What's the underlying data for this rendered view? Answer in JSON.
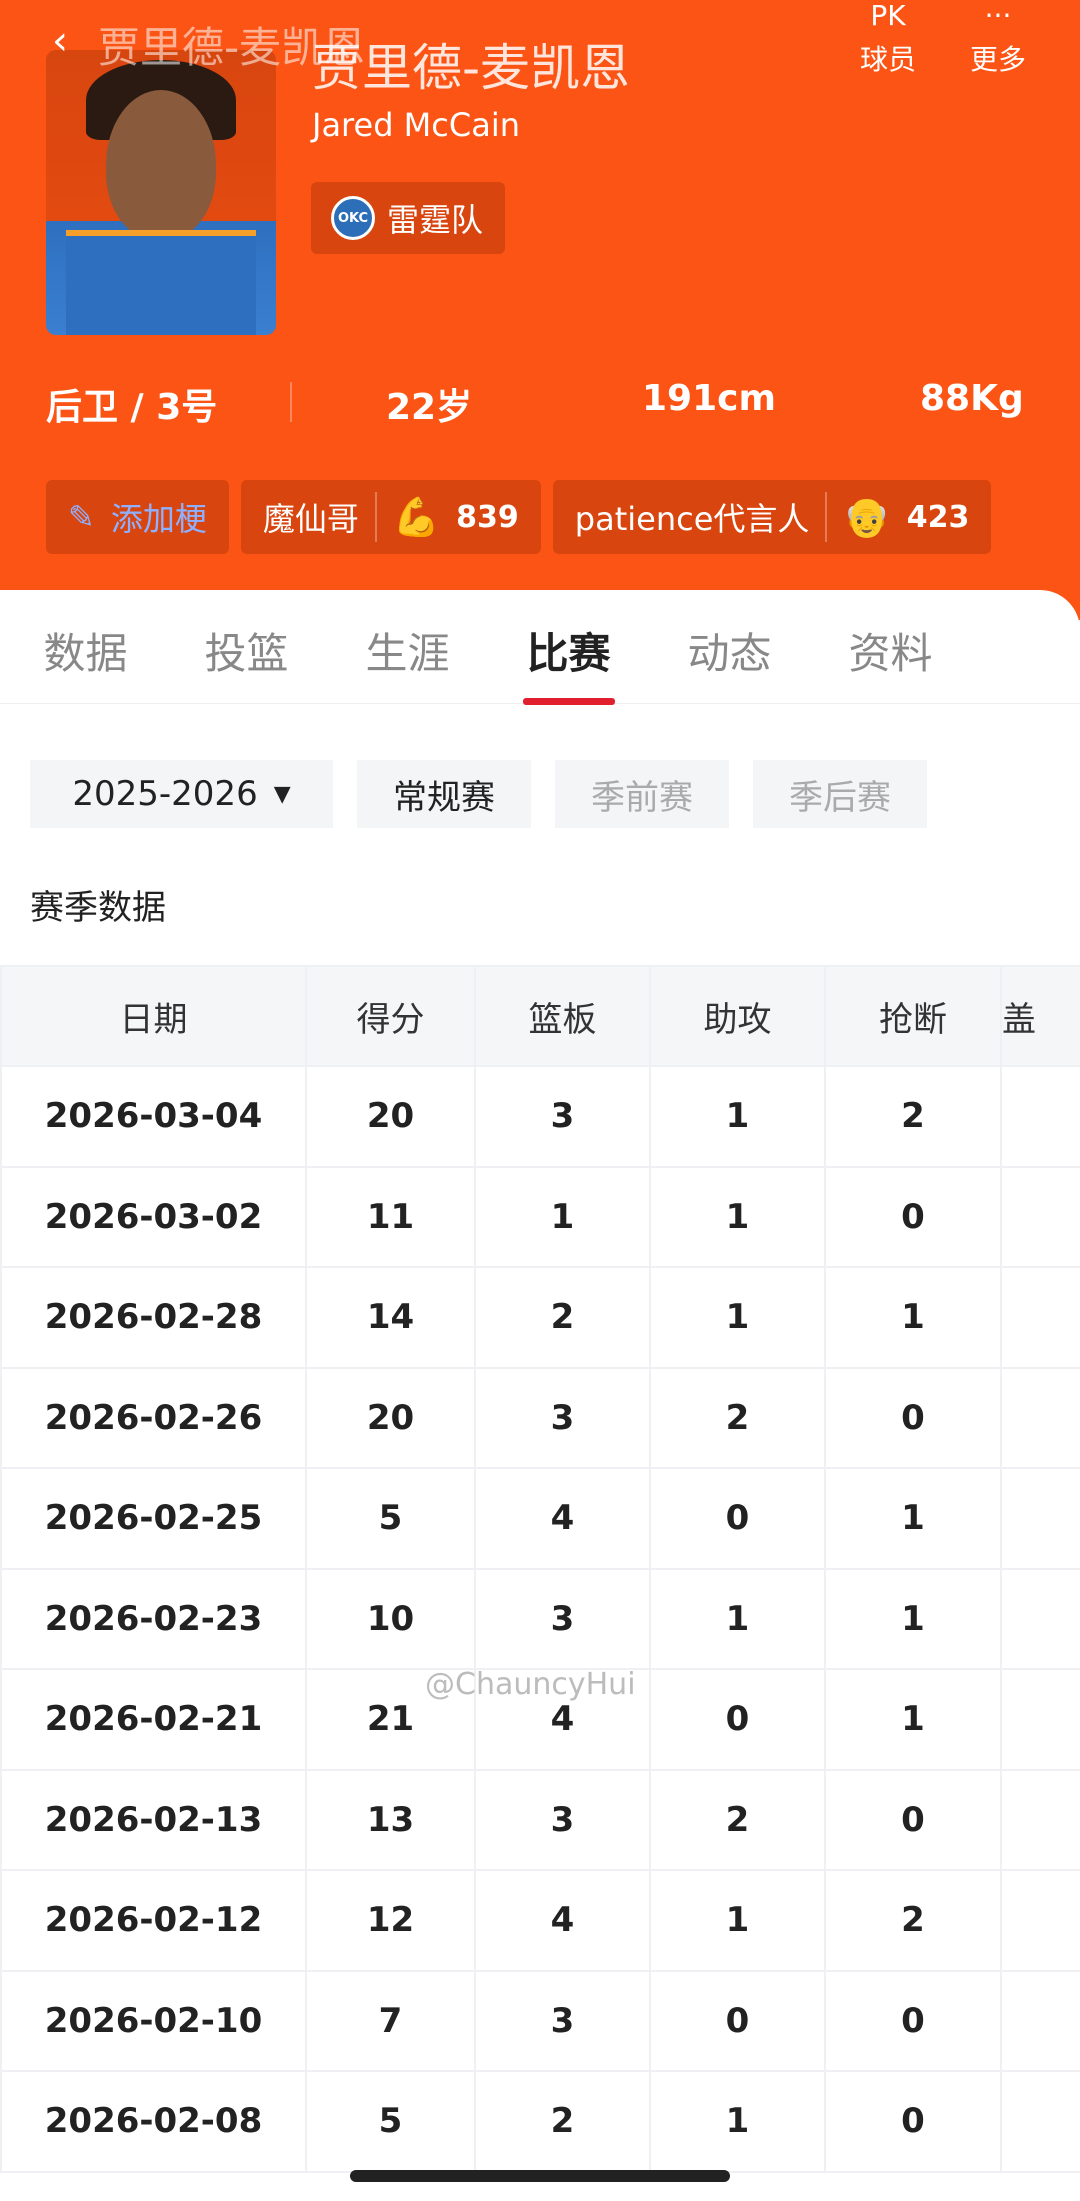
{
  "header": {
    "back_watermark": "贾里德-麦凯恩",
    "name_cn": "贾里德-麦凯恩",
    "name_en": "Jared McCain",
    "team": "雷霆队",
    "team_logo": "OKC",
    "pk_icon": "PK",
    "pk_label": "球员",
    "more_icon": "···",
    "more_label": "更多"
  },
  "stats": {
    "position": "后卫 / 3号",
    "age": "22岁",
    "height": "191cm",
    "weight": "88Kg"
  },
  "tags": {
    "add": "添加梗",
    "tag1": "魔仙哥",
    "tag1_count": "839",
    "tag2": "patience代言人",
    "tag2_count": "423"
  },
  "tabs": [
    "数据",
    "投篮",
    "生涯",
    "比赛",
    "动态",
    "资料"
  ],
  "active_tab": "比赛",
  "filters": {
    "season": "2025-2026",
    "regular": "常规赛",
    "pre": "季前赛",
    "post": "季后赛"
  },
  "section_title": "赛季数据",
  "table": {
    "headers": [
      "日期",
      "得分",
      "篮板",
      "助攻",
      "抢断",
      "盖"
    ],
    "rows": [
      [
        "2026-03-04",
        "20",
        "3",
        "1",
        "2"
      ],
      [
        "2026-03-02",
        "11",
        "1",
        "1",
        "0"
      ],
      [
        "2026-02-28",
        "14",
        "2",
        "1",
        "1"
      ],
      [
        "2026-02-26",
        "20",
        "3",
        "2",
        "0"
      ],
      [
        "2026-02-25",
        "5",
        "4",
        "0",
        "1"
      ],
      [
        "2026-02-23",
        "10",
        "3",
        "1",
        "1"
      ],
      [
        "2026-02-21",
        "21",
        "4",
        "0",
        "1"
      ],
      [
        "2026-02-13",
        "13",
        "3",
        "2",
        "0"
      ],
      [
        "2026-02-12",
        "12",
        "4",
        "1",
        "2"
      ],
      [
        "2026-02-10",
        "7",
        "3",
        "0",
        "0"
      ],
      [
        "2026-02-08",
        "5",
        "2",
        "1",
        "0"
      ]
    ]
  },
  "watermark": "@ChauncyHui"
}
